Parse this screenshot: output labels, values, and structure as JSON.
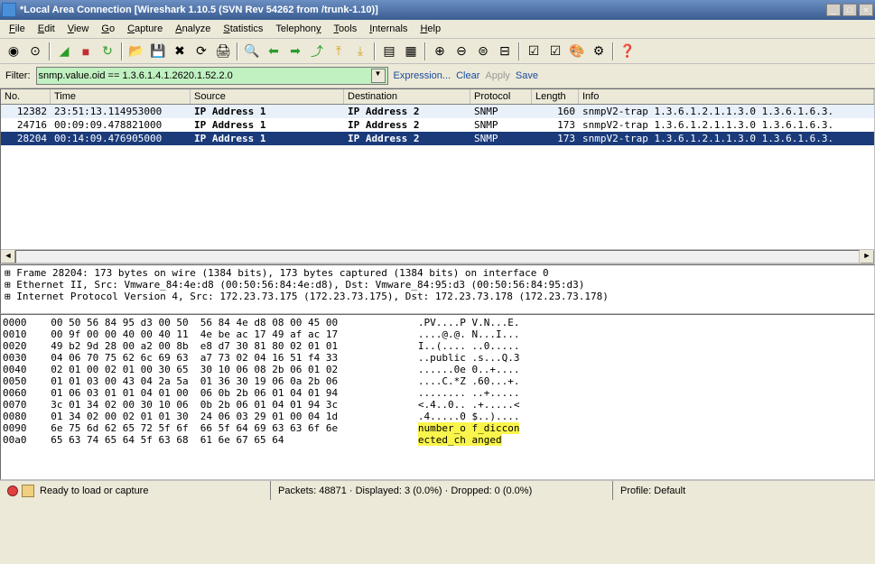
{
  "title": "*Local Area Connection   [Wireshark 1.10.5  (SVN Rev 54262 from /trunk-1.10)]",
  "menu": [
    "File",
    "Edit",
    "View",
    "Go",
    "Capture",
    "Analyze",
    "Statistics",
    "Telephony",
    "Tools",
    "Internals",
    "Help"
  ],
  "filter": {
    "label": "Filter:",
    "value": "snmp.value.oid == 1.3.6.1.4.1.2620.1.52.2.0",
    "expression": "Expression...",
    "clear": "Clear",
    "apply": "Apply",
    "save": "Save"
  },
  "columns": [
    "No.",
    "Time",
    "Source",
    "Destination",
    "Protocol",
    "Length",
    "Info"
  ],
  "packets": [
    {
      "no": "12382",
      "time": "23:51:13.114953000",
      "src": "IP Address 1",
      "dst": "IP Address 2",
      "proto": "SNMP",
      "len": "160",
      "info": "snmpV2-trap 1.3.6.1.2.1.1.3.0 1.3.6.1.6.3."
    },
    {
      "no": "24716",
      "time": "00:09:09.478821000",
      "src": "IP Address 1",
      "dst": "IP Address 2",
      "proto": "SNMP",
      "len": "173",
      "info": "snmpV2-trap 1.3.6.1.2.1.1.3.0 1.3.6.1.6.3."
    },
    {
      "no": "28204",
      "time": "00:14:09.476905000",
      "src": "IP Address 1",
      "dst": "IP Address 2",
      "proto": "SNMP",
      "len": "173",
      "info": "snmpV2-trap 1.3.6.1.2.1.1.3.0 1.3.6.1.6.3."
    }
  ],
  "details": [
    "⊞ Frame 28204: 173 bytes on wire (1384 bits), 173 bytes captured (1384 bits) on interface 0",
    "⊞ Ethernet II, Src: Vmware_84:4e:d8 (00:50:56:84:4e:d8), Dst: Vmware_84:95:d3 (00:50:56:84:95:d3)",
    "⊞ Internet Protocol Version 4, Src: 172.23.73.175 (172.23.73.175), Dst: 172.23.73.178 (172.23.73.178)"
  ],
  "hex": [
    {
      "off": "0000",
      "b": "00 50 56 84 95 d3 00 50  56 84 4e d8 08 00 45 00",
      "a": ".PV....P V.N...E."
    },
    {
      "off": "0010",
      "b": "00 9f 00 00 40 00 40 11  4e be ac 17 49 af ac 17",
      "a": "....@.@. N...I..."
    },
    {
      "off": "0020",
      "b": "49 b2 9d 28 00 a2 00 8b  e8 d7 30 81 80 02 01 01",
      "a": "I..(.... ..0....."
    },
    {
      "off": "0030",
      "b": "04 06 70 75 62 6c 69 63  a7 73 02 04 16 51 f4 33",
      "a": "..public .s...Q.3"
    },
    {
      "off": "0040",
      "b": "02 01 00 02 01 00 30 65  30 10 06 08 2b 06 01 02",
      "a": "......0e 0..+...."
    },
    {
      "off": "0050",
      "b": "01 01 03 00 43 04 2a 5a  01 36 30 19 06 0a 2b 06",
      "a": "....C.*Z .60...+."
    },
    {
      "off": "0060",
      "b": "01 06 03 01 01 04 01 00  06 0b 2b 06 01 04 01 94",
      "a": "........ ..+....."
    },
    {
      "off": "0070",
      "b": "3c 01 34 02 00 30 10 06  0b 2b 06 01 04 01 94 3c",
      "a": "<.4..0.. .+.....<"
    },
    {
      "off": "0080",
      "b": "01 34 02 00 02 01 01 30  24 06 03 29 01 00 04 1d",
      "a": ".4.....0 $..)...."
    },
    {
      "off": "0090",
      "b": "6e 75 6d 62 65 72 5f 6f  66 5f 64 69 63 63 6f 6e",
      "a": "number_o f_diccon",
      "hl": true
    },
    {
      "off": "00a0",
      "b": "65 63 74 65 64 5f 63 68  61 6e 67 65 64",
      "a": "ected_ch anged",
      "hl": true
    }
  ],
  "status": {
    "ready": "Ready to load or capture",
    "packets": "Packets: 48871 · Displayed: 3 (0.0%) · Dropped: 0 (0.0%)",
    "profile": "Profile: Default"
  }
}
